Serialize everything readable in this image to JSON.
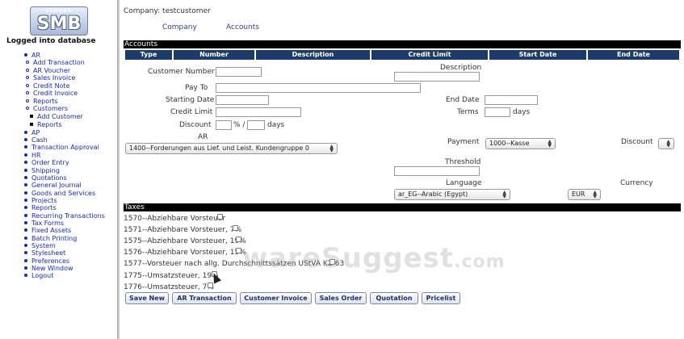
{
  "logo": {
    "top_text": "LEDGER",
    "main_text": "SMB"
  },
  "sidebar": {
    "status": "Logged into database",
    "menu": [
      {
        "label": "AR",
        "level": 0
      },
      {
        "label": "Add Transaction",
        "level": 1
      },
      {
        "label": "AR Voucher",
        "level": 1
      },
      {
        "label": "Sales Invoice",
        "level": 1
      },
      {
        "label": "Credit Note",
        "level": 1
      },
      {
        "label": "Credit Invoice",
        "level": 1
      },
      {
        "label": "Reports",
        "level": 1
      },
      {
        "label": "Customers",
        "level": 1
      },
      {
        "label": "Add Customer",
        "level": 2
      },
      {
        "label": "Reports",
        "level": 2
      },
      {
        "label": "AP",
        "level": 0
      },
      {
        "label": "Cash",
        "level": 0
      },
      {
        "label": "Transaction Approval",
        "level": 0
      },
      {
        "label": "HR",
        "level": 0
      },
      {
        "label": "Order Entry",
        "level": 0
      },
      {
        "label": "Shipping",
        "level": 0
      },
      {
        "label": "Quotations",
        "level": 0
      },
      {
        "label": "General Journal",
        "level": 0
      },
      {
        "label": "Goods and Services",
        "level": 0
      },
      {
        "label": "Projects",
        "level": 0
      },
      {
        "label": "Reports",
        "level": 0
      },
      {
        "label": "Recurring Transactions",
        "level": 0
      },
      {
        "label": "Tax Forms",
        "level": 0
      },
      {
        "label": "Fixed Assets",
        "level": 0
      },
      {
        "label": "Batch Printing",
        "level": 0
      },
      {
        "label": "System",
        "level": 0
      },
      {
        "label": "Stylesheet",
        "level": 0
      },
      {
        "label": "Preferences",
        "level": 0
      },
      {
        "label": "New Window",
        "level": 0
      },
      {
        "label": "Logout",
        "level": 0
      }
    ]
  },
  "header": {
    "company_label": "Company: testcustomer",
    "links": [
      "Company",
      "Accounts"
    ]
  },
  "accounts": {
    "bar_title": "Accounts",
    "columns": [
      "Type",
      "Number",
      "Description",
      "Credit Limit",
      "Start Date",
      "End Date"
    ]
  },
  "form": {
    "customer_number_label": "Customer Number",
    "description_label": "Description",
    "pay_to_label": "Pay To",
    "starting_date_label": "Starting Date",
    "end_date_label": "End Date",
    "credit_limit_label": "Credit Limit",
    "terms_label": "Terms",
    "terms_unit": "days",
    "discount_label": "Discount",
    "discount_pct_sep": "% /",
    "discount_days": "days",
    "ar_label": "AR",
    "ar_value": "1400--Forderungen aus Lief. und Leist. Kundengruppe 0",
    "payment_label": "Payment",
    "payment_value": "1000--Kasse",
    "discount2_label": "Discount",
    "threshold_label": "Threshold",
    "language_label": "Language",
    "language_value": "ar_EG--Arabic (Egypt)",
    "currency_label": "Currency",
    "currency_value": "EUR"
  },
  "taxes": {
    "bar_title": "Taxes",
    "items": [
      "1570--Abziehbare Vorsteuer",
      "1571--Abziehbare Vorsteuer, 7%",
      "1575--Abziehbare Vorsteuer, 19%",
      "1576--Abziehbare Vorsteuer, 15%",
      "1577--Vorsteuer nach allg. Durchschnittssätzen UStVA KZ 63",
      "1775--Umsatzsteuer, 19%",
      "1776--Umsatzsteuer, 7%"
    ]
  },
  "buttons": {
    "save_new": "Save New",
    "ar_transaction": "AR Transaction",
    "customer_invoice": "Customer Invoice",
    "sales_order": "Sales Order",
    "quotation": "Quotation",
    "pricelist": "Pricelist"
  },
  "watermark": {
    "main": "wareSuggest",
    "suffix": ".com"
  }
}
